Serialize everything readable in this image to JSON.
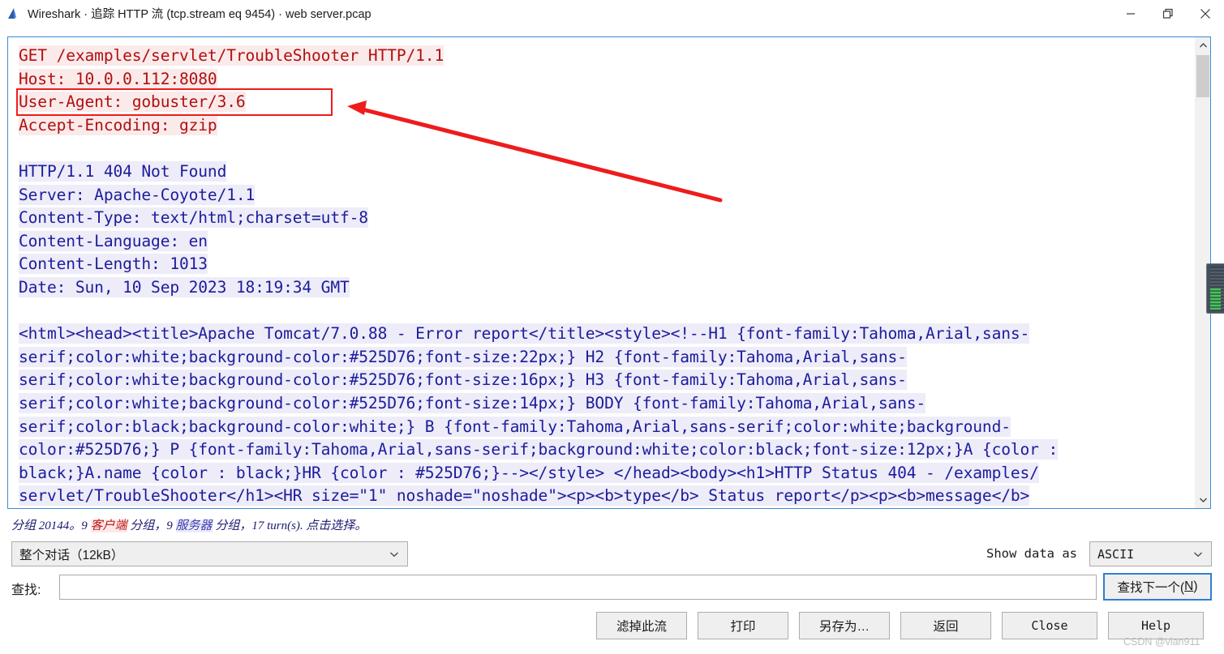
{
  "window": {
    "title": "Wireshark · 追踪 HTTP 流 (tcp.stream eq 9454) · web server.pcap",
    "app_icon": "wireshark-fin-icon",
    "controls": {
      "minimize": "minimize-icon",
      "restore": "restore-icon",
      "close": "close-icon"
    }
  },
  "stream": {
    "request_lines": [
      "GET /examples/servlet/TroubleShooter HTTP/1.1",
      "Host: 10.0.0.112:8080",
      "User-Agent: gobuster/3.6",
      "Accept-Encoding: gzip"
    ],
    "response_header_lines": [
      "HTTP/1.1 404 Not Found",
      "Server: Apache-Coyote/1.1",
      "Content-Type: text/html;charset=utf-8",
      "Content-Language: en",
      "Content-Length: 1013",
      "Date: Sun, 10 Sep 2023 18:19:34 GMT"
    ],
    "response_body_lines": [
      "<html><head><title>Apache Tomcat/7.0.88 - Error report</title><style><!--H1 {font-family:Tahoma,Arial,sans-",
      "serif;color:white;background-color:#525D76;font-size:22px;} H2 {font-family:Tahoma,Arial,sans-",
      "serif;color:white;background-color:#525D76;font-size:16px;} H3 {font-family:Tahoma,Arial,sans-",
      "serif;color:white;background-color:#525D76;font-size:14px;} BODY {font-family:Tahoma,Arial,sans-",
      "serif;color:black;background-color:white;} B {font-family:Tahoma,Arial,sans-serif;color:white;background-",
      "color:#525D76;} P {font-family:Tahoma,Arial,sans-serif;background:white;color:black;font-size:12px;}A {color :",
      "black;}A.name {color : black;}HR {color : #525D76;}--></style> </head><body><h1>HTTP Status 404 - /examples/",
      "servlet/TroubleShooter</h1><HR size=\"1\" noshade=\"noshade\"><p><b>type</b> Status report</p><p><b>message</b>"
    ],
    "colors": {
      "request_text": "#b01010",
      "request_bg": "#fbeaea",
      "response_text": "#1c1c9c",
      "response_bg": "#edecf8",
      "annotation": "#ee1c1c",
      "focus_border": "#3d8bd6"
    }
  },
  "status": {
    "prefix": "分组 20144。9 ",
    "client": "客户端",
    "middle": " 分组，9 ",
    "server": "服务器",
    "suffix": " 分组，17 turn(s). 点击选择。"
  },
  "controls": {
    "stream_selector_value": "整个对话（12kB）",
    "show_data_as_label": "Show data as",
    "show_data_as_value": "ASCII",
    "chevron_icon": "chevron-down-icon"
  },
  "find": {
    "label": "查找:",
    "value": "",
    "placeholder": "",
    "next_button_prefix": "查找下一个(",
    "next_button_mnemonic": "N",
    "next_button_suffix": ")"
  },
  "buttons": {
    "filter_out": "滤掉此流",
    "print": "打印",
    "save_as": "另存为…",
    "back": "返回",
    "close": "Close",
    "help": "Help"
  },
  "watermark": "CSDN @vlan911"
}
